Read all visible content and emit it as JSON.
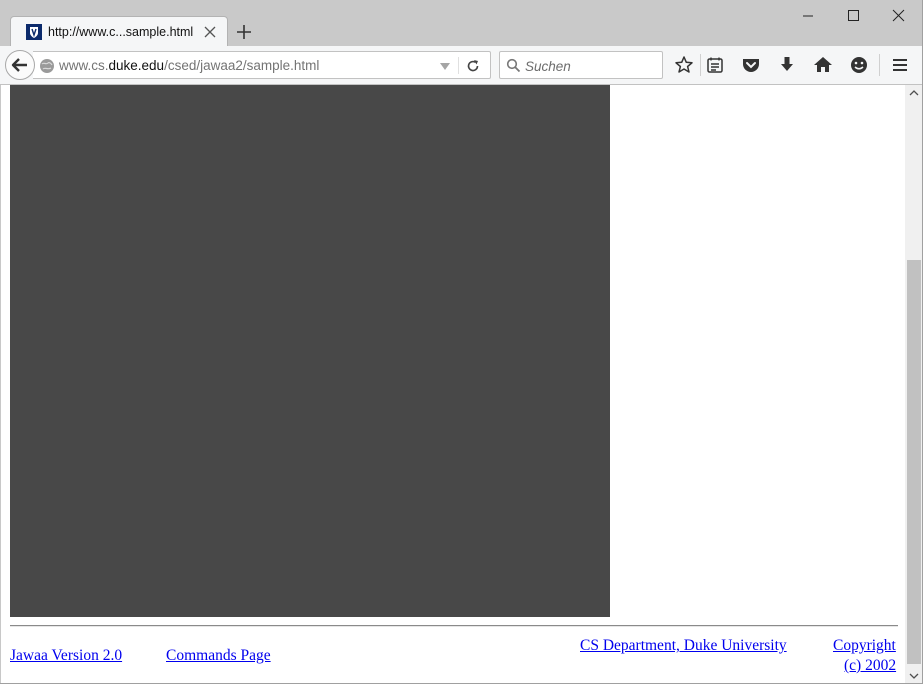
{
  "browser": {
    "tab": {
      "title": "http://www.c...sample.html",
      "favicon": "duke-shield-icon"
    },
    "url": {
      "prefix": "www.cs.",
      "domain": "duke.edu",
      "path": "/csed/jawaa2/sample.html"
    },
    "search": {
      "placeholder": "Suchen"
    },
    "toolbar_icons": [
      "bookmark-star-icon",
      "reading-list-icon",
      "pocket-icon",
      "download-icon",
      "home-icon",
      "smiley-icon",
      "menu-icon"
    ]
  },
  "page": {
    "applet": {
      "background": "#484848"
    },
    "footer": {
      "jawaa_version": "Jawaa Version 2.0",
      "commands_page": "Commands Page",
      "cs_department": "CS Department, Duke University",
      "copyright_line1": "Copyright",
      "copyright_line2": "(c) 2002"
    }
  },
  "colors": {
    "link": "#0000ee",
    "applet": "#484848",
    "titlebar": "#c9c9c9"
  }
}
